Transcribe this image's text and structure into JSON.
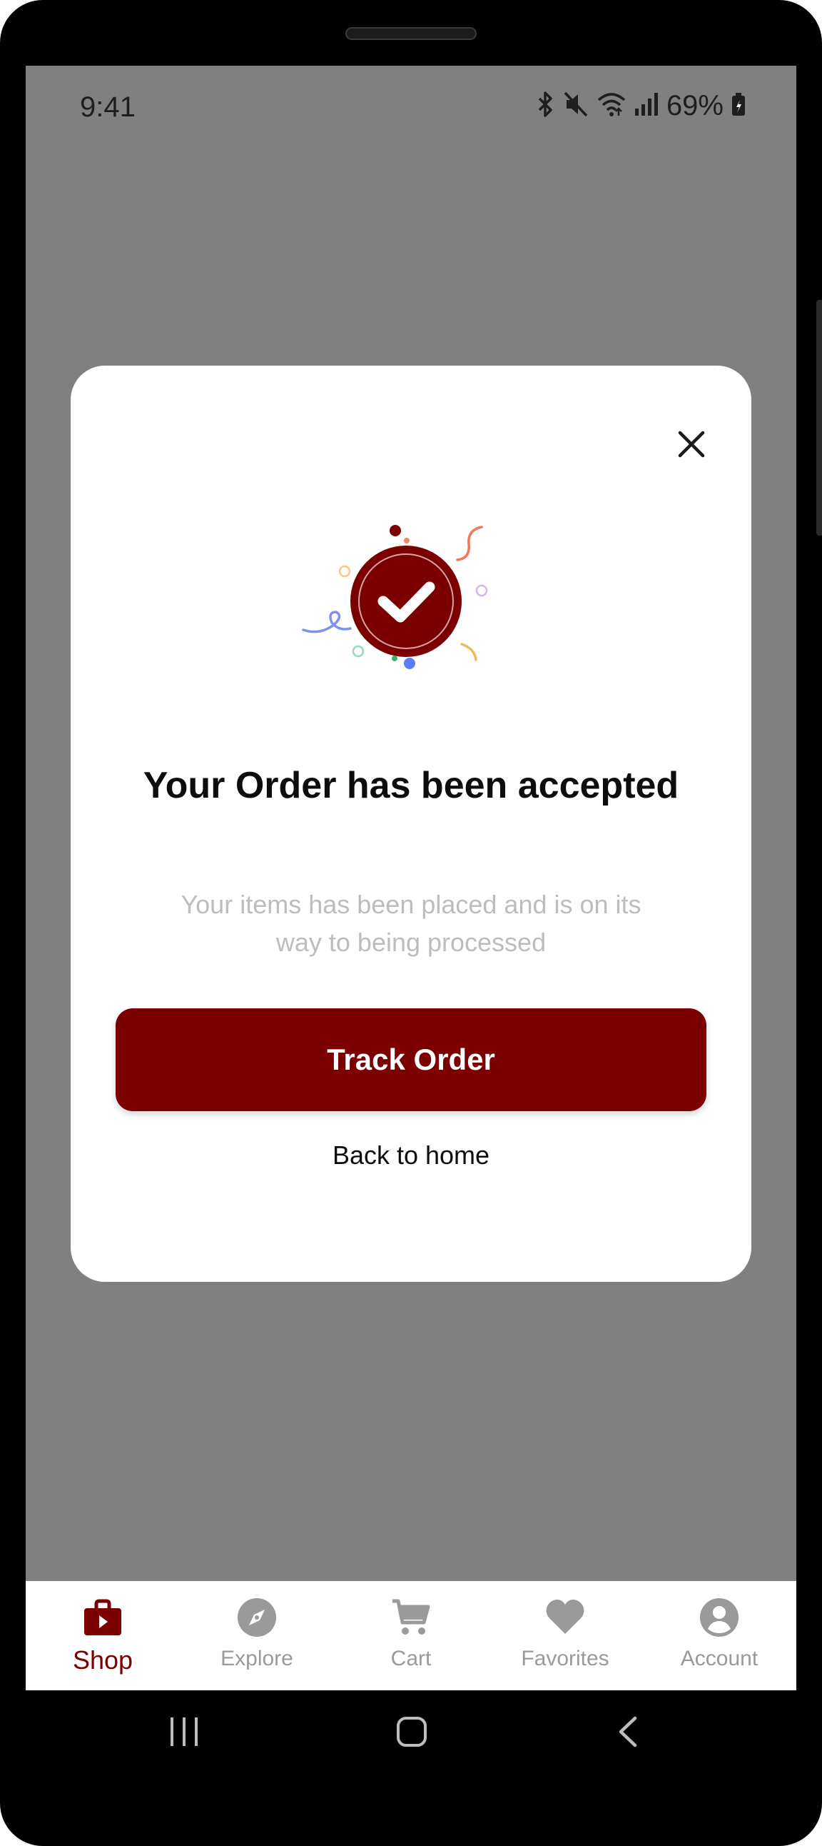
{
  "status_bar": {
    "time": "9:41",
    "battery_percent": "69%",
    "icons": [
      "bluetooth-icon",
      "mute-icon",
      "wifi-icon",
      "signal-icon",
      "battery-icon"
    ]
  },
  "modal": {
    "close_icon": "close-icon",
    "title": "Your Order has been accepted",
    "subtitle": "Your items has been placed and is on its way to being processed",
    "primary_button": "Track Order",
    "secondary_link": "Back to home"
  },
  "bottom_nav": {
    "items": [
      {
        "label": "Shop",
        "icon": "shop-bag-icon",
        "active": true
      },
      {
        "label": "Explore",
        "icon": "compass-icon",
        "active": false
      },
      {
        "label": "Cart",
        "icon": "cart-icon",
        "active": false
      },
      {
        "label": "Favorites",
        "icon": "heart-icon",
        "active": false
      },
      {
        "label": "Account",
        "icon": "account-icon",
        "active": false
      }
    ]
  },
  "system_nav": [
    "recents-icon",
    "home-icon",
    "back-icon"
  ],
  "colors": {
    "accent": "#7b0000",
    "overlay": "#808080",
    "subtitle": "#bdbdbd",
    "inactive_nav": "#9a9a9a"
  }
}
